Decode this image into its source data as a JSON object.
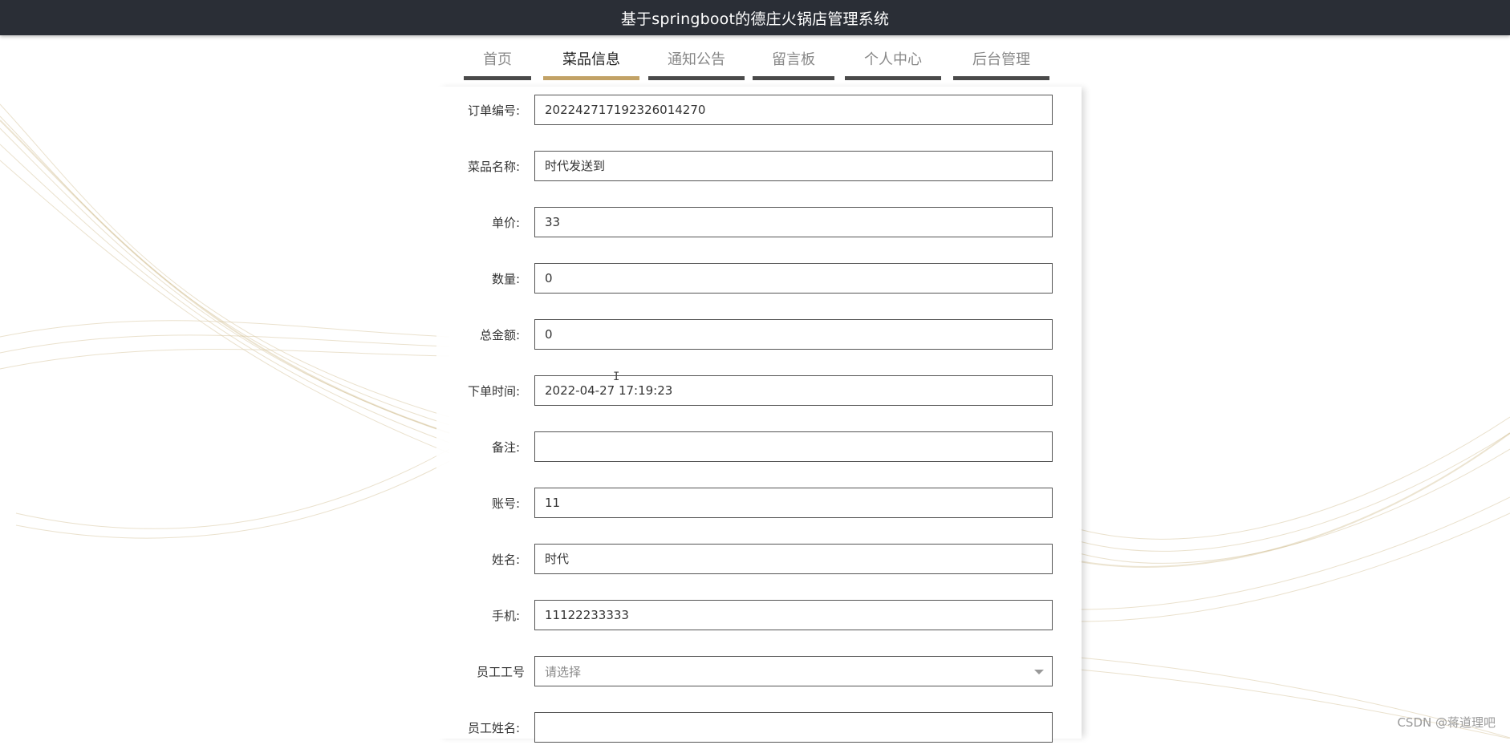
{
  "app": {
    "title": "基于springboot的德庄火锅店管理系统"
  },
  "nav": {
    "items": [
      {
        "label": "首页"
      },
      {
        "label": "菜品信息"
      },
      {
        "label": "通知公告"
      },
      {
        "label": "留言板"
      },
      {
        "label": "个人中心"
      },
      {
        "label": "后台管理"
      }
    ],
    "active": "菜品信息"
  },
  "form": {
    "fields": [
      {
        "label": "订单编号:",
        "value": "202242717192326014270"
      },
      {
        "label": "菜品名称:",
        "value": "时代发送到"
      },
      {
        "label": "单价:",
        "value": "33"
      },
      {
        "label": "数量:",
        "value": "0"
      },
      {
        "label": "总金额:",
        "value": "0"
      },
      {
        "label": "下单时间:",
        "value": "2022-04-27 17:19:23"
      },
      {
        "label": "备注:",
        "value": ""
      },
      {
        "label": "账号:",
        "value": "11"
      },
      {
        "label": "姓名:",
        "value": "时代"
      },
      {
        "label": "手机:",
        "value": "11122233333"
      },
      {
        "label": "员工工号",
        "placeholder": "请选择"
      },
      {
        "label": "员工姓名:",
        "value": ""
      }
    ]
  },
  "watermark": "CSDN @蒋道理吧",
  "colors": {
    "topbar": "#2a2e36",
    "accent": "#c2a266",
    "nav_bar": "#4a4a4a"
  }
}
